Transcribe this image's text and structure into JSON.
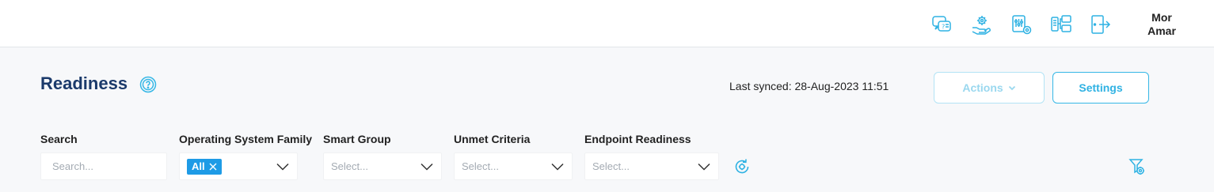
{
  "header": {
    "icons": [
      "chat-help-icon",
      "hand-gear-icon",
      "device-settings-icon",
      "devices-network-icon",
      "logout-icon"
    ],
    "user_name": "Mor Amar",
    "accent": "#35b7e6"
  },
  "page": {
    "title": "Readiness",
    "last_synced": "Last synced: 28-Aug-2023 11:51"
  },
  "actions": {
    "actions_label": "Actions",
    "settings_label": "Settings"
  },
  "filters": {
    "search": {
      "label": "Search",
      "placeholder": "Search..."
    },
    "os_family": {
      "label": "Operating System Family",
      "selected": "All"
    },
    "smart_group": {
      "label": "Smart Group",
      "placeholder": "Select..."
    },
    "unmet_criteria": {
      "label": "Unmet Criteria",
      "placeholder": "Select..."
    },
    "endpoint_readiness": {
      "label": "Endpoint Readiness",
      "placeholder": "Select..."
    }
  }
}
